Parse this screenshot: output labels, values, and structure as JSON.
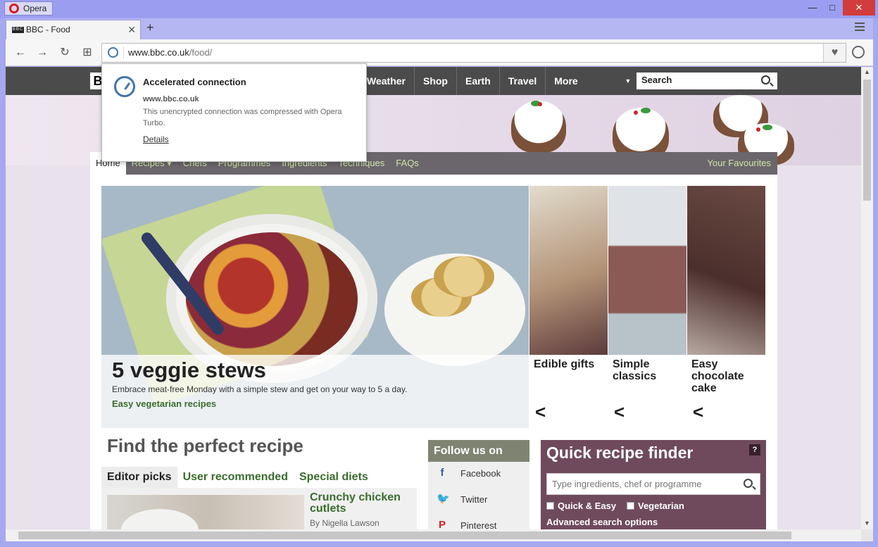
{
  "window": {
    "app_name": "Opera",
    "minimize": "—",
    "maximize": "□",
    "close": "✕"
  },
  "tab": {
    "favicon": "BBC",
    "title": "BBC - Food",
    "close": "✕",
    "new_tab": "+"
  },
  "address_bar": {
    "domain": "www.bbc.co.uk",
    "path": "/food/",
    "heart": "♥"
  },
  "toolbar": {
    "back": "←",
    "forward": "→",
    "reload": "↻",
    "speed_dial": "⊞"
  },
  "bbc_nav": {
    "logo": "B",
    "items": [
      "Weather",
      "Shop",
      "Earth",
      "Travel",
      "More"
    ],
    "search_label": "Search"
  },
  "food_nav": {
    "links": [
      "Home",
      "Recipes ▾",
      "Chefs",
      "Programmes",
      "Ingredients",
      "Techniques",
      "FAQs"
    ],
    "favourites": "Your Favourites"
  },
  "hero": {
    "headline": "5 veggie stews",
    "description": "Embrace meat-free Monday with a simple stew and get on your way to 5 a day.",
    "cta": "Easy vegetarian recipes"
  },
  "side_cards": [
    {
      "label": "Edible gifts",
      "arrow": "<"
    },
    {
      "label": "Simple classics",
      "arrow": "<"
    },
    {
      "label": "Easy chocolate cake",
      "arrow": "<"
    }
  ],
  "find_recipe": {
    "title": "Find the perfect recipe",
    "tabs": [
      "Editor picks",
      "User recommended",
      "Special diets"
    ],
    "pick_title": "Crunchy chicken cutlets",
    "pick_author": "By Nigella Lawson"
  },
  "follow": {
    "title": "Follow us on",
    "items": [
      {
        "icon": "f",
        "label": "Facebook",
        "color": "#3b5998"
      },
      {
        "icon": "🐦",
        "label": "Twitter",
        "color": "#55acee"
      },
      {
        "icon": "P",
        "label": "Pinterest",
        "color": "#cb2027"
      }
    ]
  },
  "quick_finder": {
    "title": "Quick recipe finder",
    "help": "?",
    "placeholder": "Type ingredients, chef or programme",
    "check_quick": "Quick & Easy",
    "check_veg": "Vegetarian",
    "advanced": "Advanced search options"
  },
  "popup": {
    "title": "Accelerated connection",
    "host": "www.bbc.co.uk",
    "message": "This unencrypted connection was compressed with Opera Turbo.",
    "details": "Details"
  }
}
